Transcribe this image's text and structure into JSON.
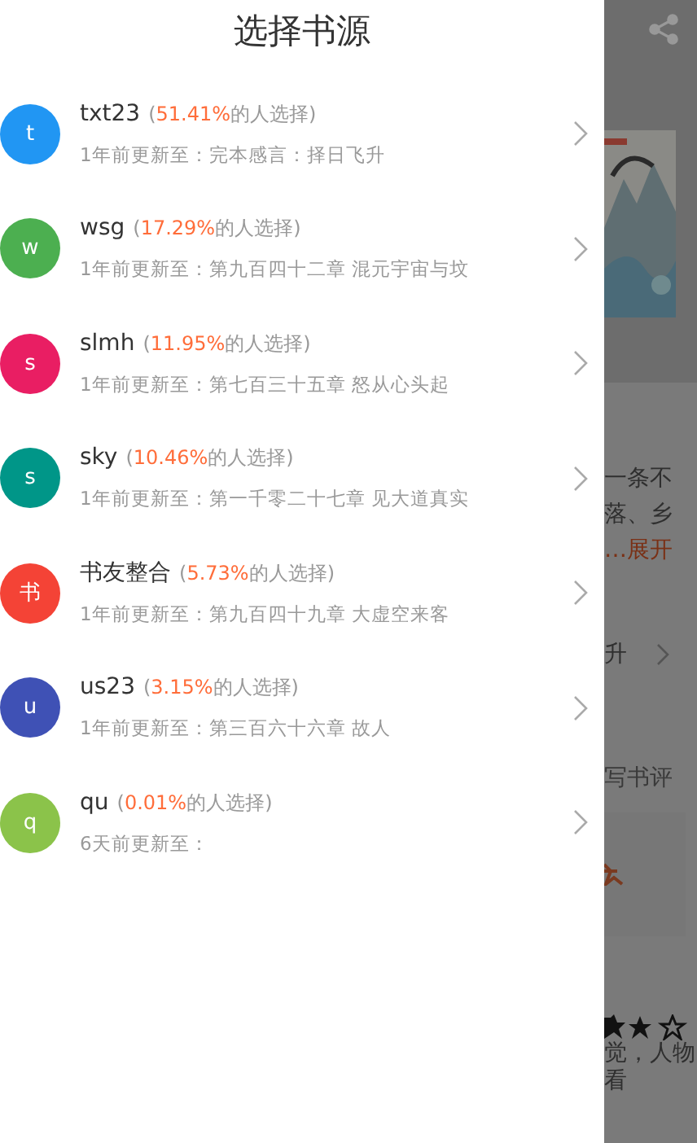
{
  "drawer": {
    "title": "选择书源",
    "sources": [
      {
        "avatar": "t",
        "color": "#2196f3",
        "name": "txt23",
        "open": "(",
        "percent": "51.41%",
        "after": "的人选择)",
        "update": "1年前更新至：完本感言：择日飞升"
      },
      {
        "avatar": "w",
        "color": "#4caf50",
        "name": "wsg",
        "open": "(",
        "percent": "17.29%",
        "after": "的人选择)",
        "update": "1年前更新至：第九百四十二章 混元宇宙与坟"
      },
      {
        "avatar": "s",
        "color": "#e91e63",
        "name": "slmh",
        "open": "(",
        "percent": "11.95%",
        "after": "的人选择)",
        "update": "1年前更新至：第七百三十五章 怒从心头起"
      },
      {
        "avatar": "s",
        "color": "#009688",
        "name": "sky",
        "open": "(",
        "percent": "10.46%",
        "after": "的人选择)",
        "update": "1年前更新至：第一千零二十七章 见大道真实"
      },
      {
        "avatar": "书",
        "color": "#f44336",
        "name": "书友整合",
        "open": "(",
        "percent": "5.73%",
        "after": "的人选择)",
        "update": "1年前更新至：第九百四十九章 大虚空来客"
      },
      {
        "avatar": "u",
        "color": "#3f51b5",
        "name": "us23",
        "open": "(",
        "percent": "3.15%",
        "after": "的人选择)",
        "update": "1年前更新至：第三百六十六章 故人"
      },
      {
        "avatar": "q",
        "color": "#8bc34a",
        "name": "qu",
        "open": "(",
        "percent": "0.01%",
        "after": "的人选择)",
        "update": "6天前更新至："
      }
    ]
  },
  "background_page": {
    "intro_lines": [
      "一条不",
      "落、乡"
    ],
    "expand": "…展开",
    "chapter": "升",
    "review": "写书评",
    "comment_lines": [
      "觉，人物",
      "看"
    ]
  }
}
